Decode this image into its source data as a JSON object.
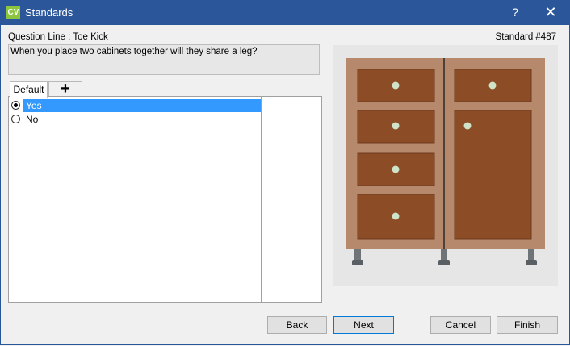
{
  "window": {
    "app_icon": "CV",
    "title": "Standards",
    "help_label": "?",
    "close_label": "✕"
  },
  "question_line": "Question Line : Toe Kick",
  "standard_number": "Standard #487",
  "question_text": "When you place two cabinets together will they share a leg?",
  "tabs": {
    "default_label": "Default",
    "add_label": "+"
  },
  "options": [
    {
      "label": "Yes",
      "selected": true
    },
    {
      "label": "No",
      "selected": false
    }
  ],
  "preview": {
    "image": "base-cabinet-drawers-and-door",
    "colors": {
      "frame": "#b7896c",
      "panel": "#8b4c26",
      "knob": "#cfe3c8",
      "leg": "#6f7478",
      "background": "#e6e6e6"
    }
  },
  "buttons": {
    "back": "Back",
    "next": "Next",
    "cancel": "Cancel",
    "finish": "Finish"
  }
}
